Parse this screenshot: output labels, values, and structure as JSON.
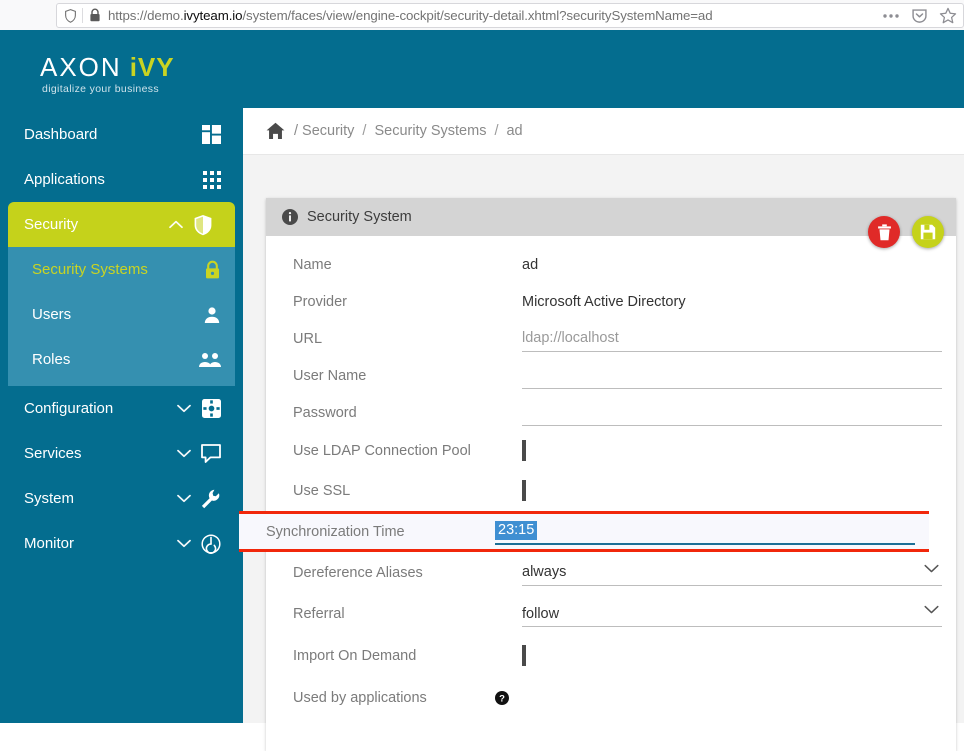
{
  "browser": {
    "url_prefix": "https://demo.",
    "url_domain": "ivyteam.io",
    "url_path": "/system/faces/view/engine-cockpit/security-detail.xhtml?securitySystemName=ad",
    "shield_icon": "shield-icon",
    "lock_icon": "padlock-icon",
    "menu_icon": "ellipsis-icon",
    "pocket_icon": "pocket-save-icon",
    "bookmark_icon": "star-icon"
  },
  "brand": {
    "name_white": "AXON",
    "name_accent": "iVY",
    "tagline": "digitalize your business",
    "teal": "#046d8f",
    "accent": "#c5d21b",
    "submenu_bg": "#3590b0"
  },
  "sidebar": {
    "items": [
      {
        "label": "Dashboard",
        "icon": "dashboard-grid-icon",
        "chevron": "",
        "state": "normal"
      },
      {
        "label": "Applications",
        "icon": "apps-grid-icon",
        "chevron": "",
        "state": "normal"
      },
      {
        "label": "Security",
        "icon": "shield-icon",
        "chevron": "chevron-up-icon",
        "state": "active"
      },
      {
        "label": "Configuration",
        "icon": "gear-icon",
        "chevron": "chevron-down-icon",
        "state": "normal"
      },
      {
        "label": "Services",
        "icon": "speech-bubble-icon",
        "chevron": "chevron-down-icon",
        "state": "normal"
      },
      {
        "label": "System",
        "icon": "wrench-icon",
        "chevron": "chevron-down-icon",
        "state": "normal"
      },
      {
        "label": "Monitor",
        "icon": "power-radar-icon",
        "chevron": "chevron-down-icon",
        "state": "normal"
      }
    ],
    "submenu": [
      {
        "label": "Security Systems",
        "icon": "padlock-icon",
        "state": "selected"
      },
      {
        "label": "Users",
        "icon": "person-icon",
        "state": "normal"
      },
      {
        "label": "Roles",
        "icon": "people-icon",
        "state": "normal"
      }
    ]
  },
  "breadcrumb": {
    "home_icon": "home-icon",
    "separator": "/",
    "items": [
      "Security",
      "Security Systems",
      "ad"
    ]
  },
  "card": {
    "info_icon": "info-icon",
    "title": "Security System",
    "delete_label": "trash-icon",
    "save_label": "floppy-disk-icon",
    "fields": [
      {
        "label": "Name",
        "value": "ad",
        "kind": "static"
      },
      {
        "label": "Provider",
        "value": "Microsoft Active Directory",
        "kind": "static"
      },
      {
        "label": "URL",
        "value": "ldap://localhost",
        "kind": "input"
      },
      {
        "label": "User Name",
        "value": "",
        "kind": "input"
      },
      {
        "label": "Password",
        "value": "",
        "kind": "input"
      },
      {
        "label": "Use LDAP Connection Pool",
        "value": "",
        "kind": "checkbox",
        "checked": false
      },
      {
        "label": "Use SSL",
        "value": "",
        "kind": "checkbox",
        "checked": false
      },
      {
        "label": "Synchronization Time",
        "value": "23:15",
        "kind": "input-focused-selected",
        "highlight": "#f1270b"
      },
      {
        "label": "Dereference Aliases",
        "value": "always",
        "kind": "select"
      },
      {
        "label": "Referral",
        "value": "follow",
        "kind": "select"
      },
      {
        "label": "Import On Demand",
        "value": "",
        "kind": "checkbox",
        "checked": false
      },
      {
        "label": "Used by applications",
        "value": "",
        "kind": "help"
      }
    ]
  }
}
